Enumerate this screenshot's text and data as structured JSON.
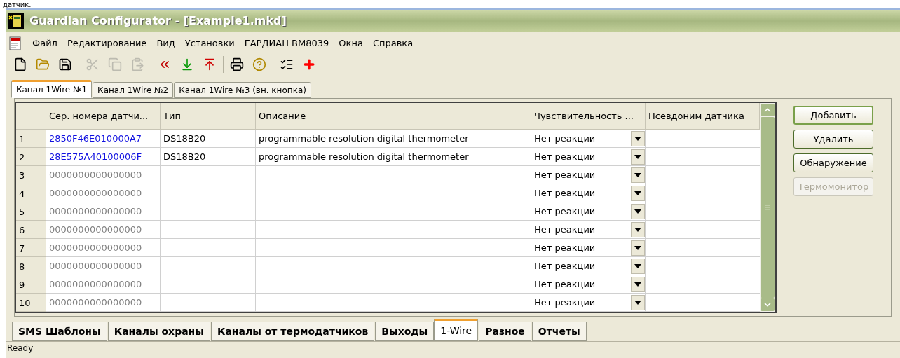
{
  "page_top_text": "датчик.",
  "window": {
    "title": "Guardian Configurator - [Example1.mkd]"
  },
  "menu": [
    "Файл",
    "Редактирование",
    "Вид",
    "Установки",
    "ГАРДИАН ВМ8039",
    "Окна",
    "Справка"
  ],
  "toolbar": [
    {
      "kind": "new",
      "disabled": false
    },
    {
      "kind": "open",
      "disabled": false
    },
    {
      "kind": "save",
      "disabled": false
    },
    {
      "kind": "cut",
      "disabled": true
    },
    {
      "kind": "copy",
      "disabled": true
    },
    {
      "kind": "paste",
      "disabled": true
    },
    {
      "kind": "rewind",
      "disabled": false
    },
    {
      "kind": "download",
      "disabled": false
    },
    {
      "kind": "upload",
      "disabled": false
    },
    {
      "kind": "print",
      "disabled": false
    },
    {
      "kind": "help",
      "disabled": false
    },
    {
      "kind": "checklist",
      "disabled": false
    },
    {
      "kind": "cross",
      "disabled": false
    }
  ],
  "channel_tabs": [
    {
      "label": "Канал 1Wire №1",
      "selected": true
    },
    {
      "label": "Канал 1Wire №2",
      "selected": false
    },
    {
      "label": "Канал 1Wire №3 (вн. кнопка)",
      "selected": false
    }
  ],
  "table": {
    "columns": [
      "Сер. номера датчи...",
      "Тип",
      "Описание",
      "Чувствительность ...",
      "Псевдоним датчика"
    ],
    "rows": [
      {
        "index": "1",
        "serial": "2850F46E010000A7",
        "kind": "found",
        "type": "DS18B20",
        "description": "programmable resolution digital thermometer",
        "sensitivity": "Нет реакции"
      },
      {
        "index": "2",
        "serial": "28E575A40100006F",
        "kind": "found",
        "type": "DS18B20",
        "description": "programmable resolution digital thermometer",
        "sensitivity": "Нет реакции"
      },
      {
        "index": "3",
        "serial": "0000000000000000",
        "kind": "empty",
        "sensitivity": "Нет реакции"
      },
      {
        "index": "4",
        "serial": "0000000000000000",
        "kind": "empty",
        "sensitivity": "Нет реакции"
      },
      {
        "index": "5",
        "serial": "0000000000000000",
        "kind": "empty",
        "sensitivity": "Нет реакции"
      },
      {
        "index": "6",
        "serial": "0000000000000000",
        "kind": "empty",
        "sensitivity": "Нет реакции"
      },
      {
        "index": "7",
        "serial": "0000000000000000",
        "kind": "empty",
        "sensitivity": "Нет реакции"
      },
      {
        "index": "8",
        "serial": "0000000000000000",
        "kind": "empty",
        "sensitivity": "Нет реакции"
      },
      {
        "index": "9",
        "serial": "0000000000000000",
        "kind": "empty",
        "sensitivity": "Нет реакции"
      },
      {
        "index": "10",
        "serial": "0000000000000000",
        "kind": "empty",
        "sensitivity": "Нет реакции"
      }
    ]
  },
  "buttons": [
    {
      "label": "Добавить",
      "disabled": false,
      "default": true
    },
    {
      "label": "Удалить",
      "disabled": false,
      "default": false
    },
    {
      "label": "Обнаружение",
      "disabled": false,
      "default": false
    },
    {
      "label": "Термомонитор",
      "disabled": true,
      "default": false
    }
  ],
  "section_tabs": [
    {
      "label": "SMS Шаблоны",
      "selected": false
    },
    {
      "label": "Каналы охраны",
      "selected": false
    },
    {
      "label": "Каналы от термодатчиков",
      "selected": false
    },
    {
      "label": "Выходы",
      "selected": false
    },
    {
      "label": "1-Wire",
      "selected": true
    },
    {
      "label": "Разное",
      "selected": false
    },
    {
      "label": "Отчеты",
      "selected": false
    }
  ],
  "status_bar": "Ready"
}
